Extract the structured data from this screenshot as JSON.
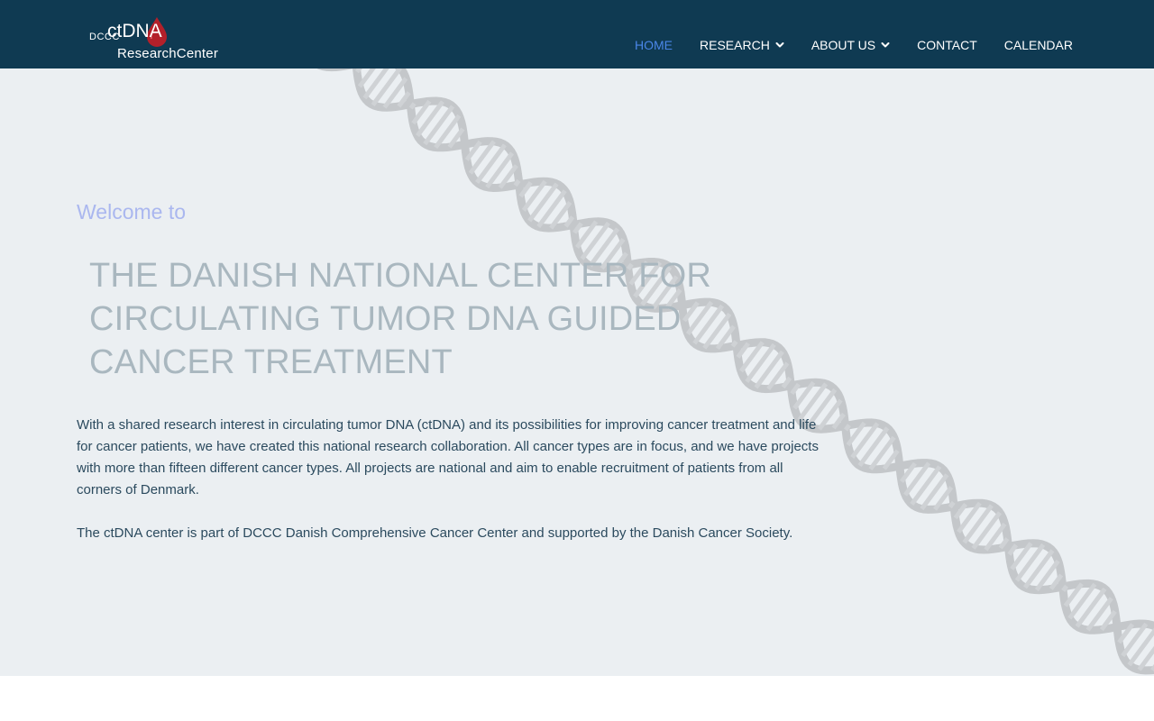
{
  "logo": {
    "small": "DCCC",
    "big": "ctDNA",
    "sub": "ResearchCenter"
  },
  "nav": {
    "items": [
      {
        "label": "HOME",
        "active": true
      },
      {
        "label": "RESEARCH",
        "dropdown": true
      },
      {
        "label": "ABOUT US",
        "dropdown": true
      },
      {
        "label": "CONTACT"
      },
      {
        "label": "CALENDAR"
      }
    ]
  },
  "hero": {
    "welcome": "Welcome to",
    "title": "THE DANISH NATIONAL CENTER FOR CIRCULATING TUMOR DNA GUIDED CANCER TREATMENT",
    "paragraph1": "With a shared research interest in circulating tumor DNA (ctDNA) and its possibilities for improving cancer treatment and life for cancer patients, we have created this national research collaboration. All cancer types are in focus, and we have projects with more than fifteen different cancer types. All projects are national and aim to enable recruitment of patients from all corners of Denmark.",
    "paragraph2": "The ctDNA center is part of DCCC Danish Comprehensive Cancer Center and supported by the Danish Cancer Society."
  },
  "colors": {
    "header_bg": "#0f3a52",
    "nav_active": "#4a86e8",
    "hero_bg": "#ebeff2",
    "welcome": "#aab7ef",
    "title": "#a9b7bf",
    "body_text": "#2b4a5e",
    "logo_drop": "#b3202a"
  },
  "icons": {
    "dropdown": "chevron-down-icon",
    "logo_mark": "blood-drop-icon",
    "background": "dna-helix-icon"
  }
}
